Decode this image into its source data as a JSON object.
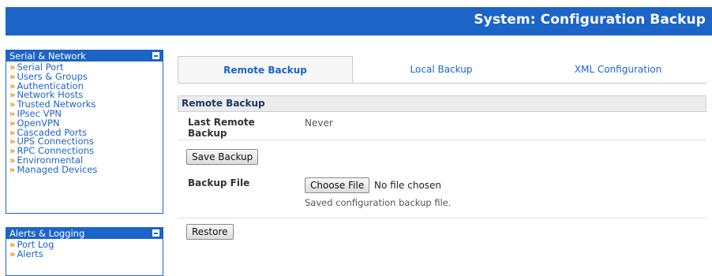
{
  "header": {
    "title": "System: Configuration Backup"
  },
  "sidebar": {
    "panels": [
      {
        "title": "Serial & Network",
        "items": [
          "Serial Port",
          "Users & Groups",
          "Authentication",
          "Network Hosts",
          "Trusted Networks",
          "IPsec VPN",
          "OpenVPN",
          "Cascaded Ports",
          "UPS Connections",
          "RPC Connections",
          "Environmental",
          "Managed Devices"
        ]
      },
      {
        "title": "Alerts & Logging",
        "items": [
          "Port Log",
          "Alerts"
        ]
      }
    ],
    "bullet": "»"
  },
  "tabs": [
    {
      "label": "Remote Backup",
      "active": true
    },
    {
      "label": "Local Backup",
      "active": false
    },
    {
      "label": "XML Configuration",
      "active": false
    }
  ],
  "section": {
    "title": "Remote Backup",
    "last_backup_label": "Last Remote Backup",
    "last_backup_value": "Never",
    "save_button": "Save Backup",
    "backup_file_label": "Backup File",
    "choose_file_button": "Choose File",
    "no_file_text": "No file chosen",
    "file_hint": "Saved configuration backup file.",
    "restore_button": "Restore"
  },
  "colors": {
    "brand_blue": "#1d64c8",
    "bullet_orange": "#e08a00"
  }
}
